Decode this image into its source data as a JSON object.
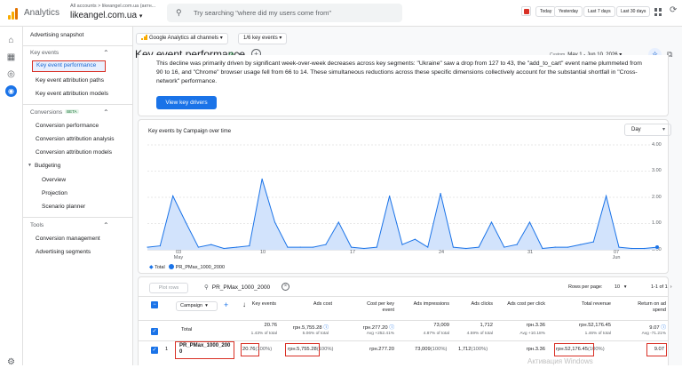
{
  "header": {
    "app_name": "Analytics",
    "account_path": "All accounts > likeangel.com.ua (актн...",
    "account_name": "likeangel.com.ua",
    "search_placeholder": "Try searching \"where did my users come from\"",
    "date_presets": [
      "Today",
      "Yesterday",
      "Last 7 days",
      "Last 30 days"
    ]
  },
  "sidebar": {
    "top_item": "Advertising snapshot",
    "sections": [
      {
        "title": "Key events",
        "items": [
          "Key event performance",
          "Key event attribution paths",
          "Key event attribution models"
        ]
      },
      {
        "title": "Conversions",
        "badge": "BETA",
        "items": [
          "Conversion performance",
          "Conversion attribution analysis",
          "Conversion attribution models"
        ]
      },
      {
        "title": "Budgeting",
        "items": [
          "Overview",
          "Projection",
          "Scenario planner"
        ]
      },
      {
        "title": "Tools",
        "items": [
          "Conversion management",
          "Advertising segments"
        ]
      }
    ]
  },
  "toolbar": {
    "channels_chip": "Google Analytics all channels",
    "filter_chip": "1/6 key events",
    "page_title": "Key event performance",
    "date_label": "Custom",
    "date_range": "May 1 - Jun 10, 2026"
  },
  "insight": {
    "text": "This decline was primarily driven by significant week-over-week decreases across key segments: \"Ukraine\" saw a drop from 127 to 43, the \"add_to_cart\" event name plummeted from 90 to 16, and \"Chrome\" browser usage fell from 66 to 14. These simultaneous reductions across these specific dimensions collectively account for the substantial shortfall in \"Cross-network\" performance.",
    "button": "View key drivers"
  },
  "chart": {
    "title": "Key events by Campaign over time",
    "granularity": "Day",
    "y_ticks": [
      "4.00",
      "3.00",
      "2.00",
      "1.00",
      "0.00"
    ],
    "x_ticks": [
      {
        "day": "03",
        "month": "May"
      },
      {
        "day": "10",
        "month": ""
      },
      {
        "day": "17",
        "month": ""
      },
      {
        "day": "24",
        "month": ""
      },
      {
        "day": "31",
        "month": ""
      },
      {
        "day": "07",
        "month": "Jun"
      }
    ],
    "legend": [
      "Total",
      "PR_PMax_1000_2000"
    ]
  },
  "chart_data": {
    "type": "area",
    "x": [
      "May 1",
      "May 2",
      "May 3",
      "May 4",
      "May 5",
      "May 6",
      "May 7",
      "May 8",
      "May 9",
      "May 10",
      "May 11",
      "May 12",
      "May 13",
      "May 14",
      "May 15",
      "May 16",
      "May 17",
      "May 18",
      "May 19",
      "May 20",
      "May 21",
      "May 22",
      "May 23",
      "May 24",
      "May 25",
      "May 26",
      "May 27",
      "May 28",
      "May 29",
      "May 30",
      "May 31",
      "Jun 1",
      "Jun 2",
      "Jun 3",
      "Jun 4",
      "Jun 5",
      "Jun 6",
      "Jun 7",
      "Jun 8",
      "Jun 9",
      "Jun 10"
    ],
    "series": [
      {
        "name": "PR_PMax_1000_2000",
        "values": [
          0.1,
          0.15,
          2.05,
          1.05,
          0.1,
          0.2,
          0.05,
          0.1,
          0.15,
          2.7,
          1.05,
          0.1,
          0.1,
          0.1,
          0.2,
          1.05,
          0.1,
          0.05,
          0.1,
          2.05,
          0.2,
          0.4,
          0.1,
          2.15,
          0.1,
          0.05,
          0.1,
          1.05,
          0.1,
          0.2,
          1.05,
          0.05,
          0.1,
          0.1,
          0.2,
          0.3,
          2.05,
          0.1,
          0.05,
          0.05,
          0.1
        ]
      }
    ],
    "ylim": [
      0,
      4
    ],
    "colors": {
      "line": "#1a73e8",
      "fill": "#d2e3fc"
    }
  },
  "table": {
    "plot_rows_button": "Plot rows",
    "search_value": "PR_PMax_1000_2000",
    "rows_per_page_label": "Rows per page:",
    "rows_per_page": "10",
    "page_count": "1-1 of 1",
    "dimension_select": "Campaign",
    "headers": [
      "Key events",
      "Ads cost",
      "Cost per key event",
      "Ads impressions",
      "Ads clicks",
      "Ads cost per click",
      "Total revenue",
      "Return on ad spend"
    ],
    "total_label": "Total",
    "totals": [
      "20.76",
      "грн.5,755.28",
      "грн.277.20",
      "73,009",
      "1,712",
      "грн.3.36",
      "грн.52,176.45",
      "9.07"
    ],
    "totals_sub": [
      "1.43% of total",
      "5.06% of total",
      "Avg +252.41%",
      "4.87% of total",
      "4.59% of total",
      "Avg +10.18%",
      "1.46% of total",
      "Avg -71.21%"
    ],
    "row": {
      "index": "1",
      "campaign": "PR_PMax_1000_2000",
      "values": [
        "20.76",
        "грн.5,755.28",
        "грн.277.20",
        "73,009",
        "1,712",
        "грн.3.36",
        "грн.52,176.45",
        "9.07"
      ],
      "pcts": [
        "(100%)",
        "(100%)",
        "",
        "(100%)",
        "(100%)",
        "",
        "(100%)",
        ""
      ]
    }
  },
  "watermark": "Активация Windows"
}
